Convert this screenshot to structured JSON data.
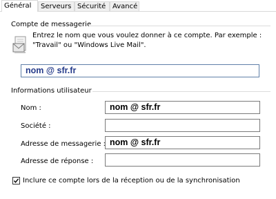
{
  "tabs": [
    {
      "label": "Général",
      "active": true
    },
    {
      "label": "Serveurs",
      "active": false
    },
    {
      "label": "Sécurité",
      "active": false
    },
    {
      "label": "Avancé",
      "active": false
    }
  ],
  "account": {
    "group_title": "Compte de messagerie",
    "description": "Entrez le nom que vous voulez donner à ce compte. Par exemple : \"Travail\" ou \"Windows Live Mail\".",
    "name_value": "nom @ sfr.fr"
  },
  "user_info": {
    "group_title": "Informations utilisateur",
    "fields": [
      {
        "label": "Nom :",
        "value": "nom @ sfr.fr"
      },
      {
        "label": "Société :",
        "value": ""
      },
      {
        "label": "Adresse de messagerie :",
        "value": "nom @ sfr.fr"
      },
      {
        "label": "Adresse de réponse :",
        "value": ""
      }
    ]
  },
  "include_sync": {
    "label": "Inclure ce compte lors de la réception ou de la synchronisation",
    "checked": true
  },
  "colors": {
    "focus_text": "#253b8a",
    "focus_border": "#5f7fa8"
  }
}
